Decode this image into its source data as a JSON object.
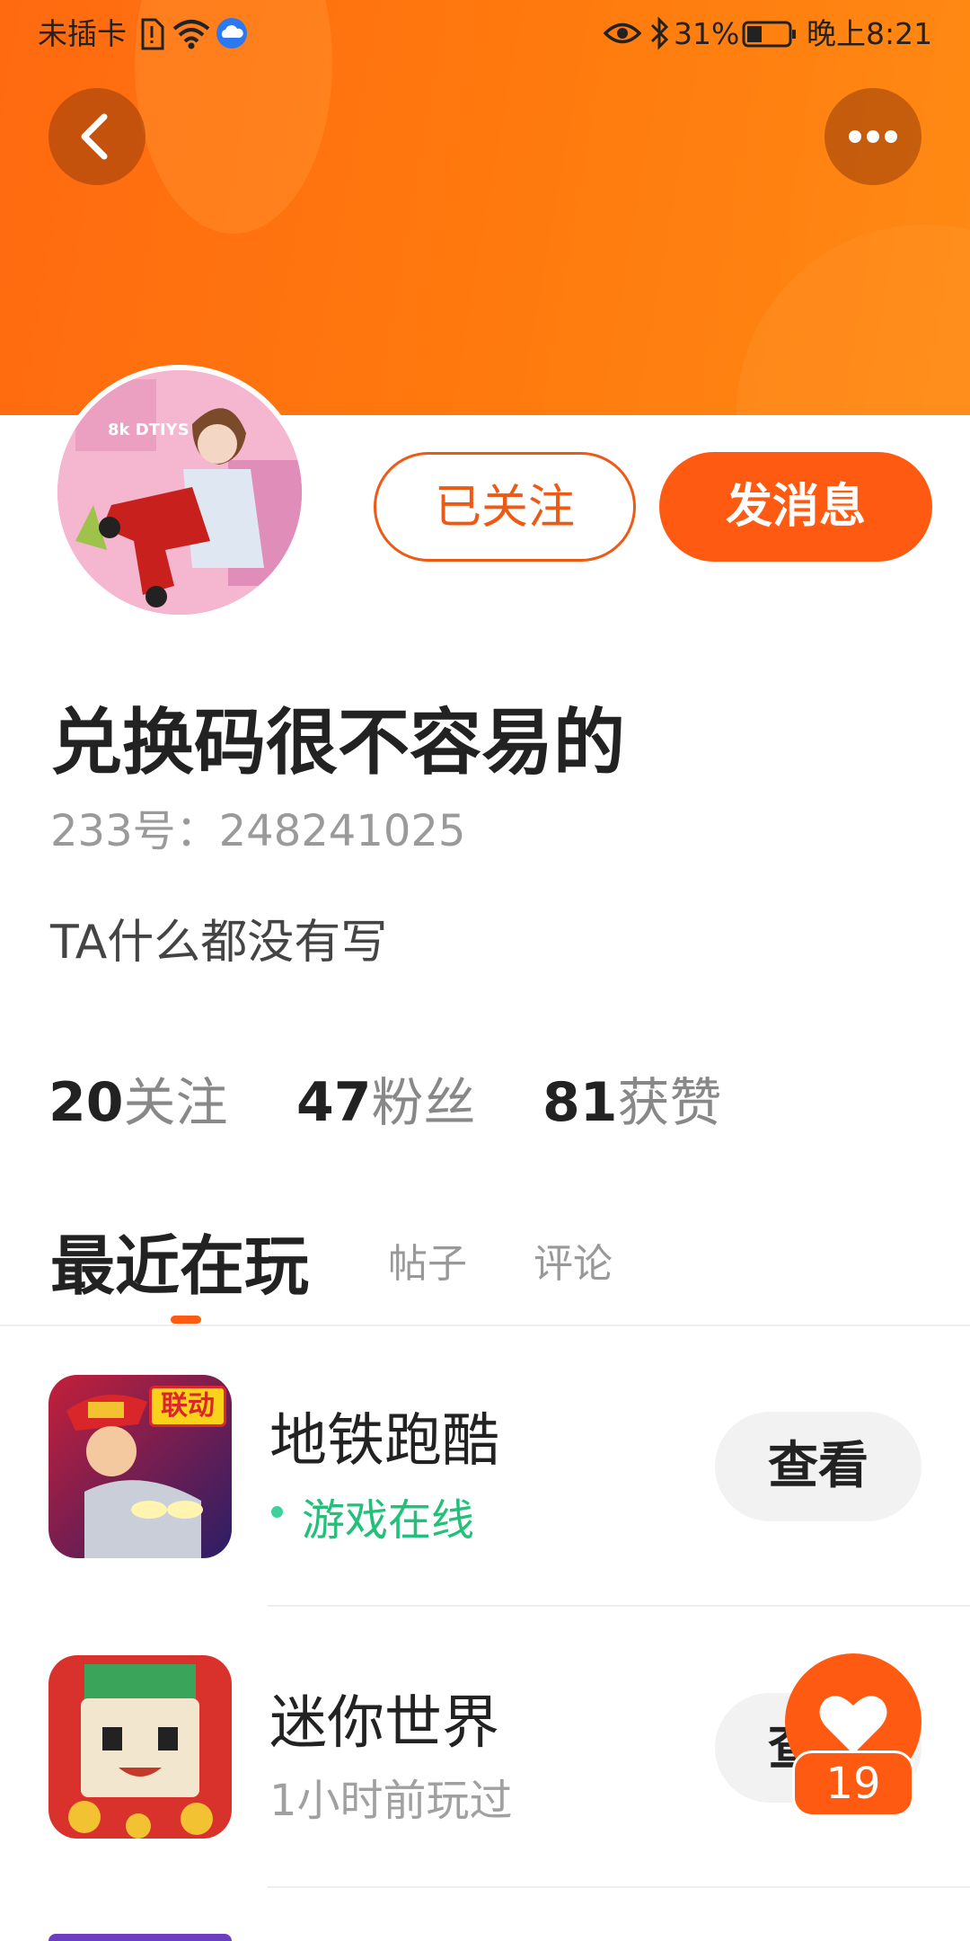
{
  "status_bar": {
    "carrier": "未插卡",
    "battery": "31%",
    "time": "晚上8:21"
  },
  "header": {
    "back_icon": "back-arrow-icon",
    "more_icon": "more-dots-icon",
    "accent_color": "#ff6a10"
  },
  "profile": {
    "avatar_text": "8k DTIYS",
    "follow_button": "已关注",
    "message_button": "发消息",
    "username": "兑换码很不容易的",
    "id_label": "233号：248241025",
    "bio": "TA什么都没有写",
    "stats": [
      {
        "value": "20",
        "label": "关注"
      },
      {
        "value": "47",
        "label": "粉丝"
      },
      {
        "value": "81",
        "label": "获赞"
      }
    ]
  },
  "tabs": [
    {
      "label": "最近在玩",
      "active": true
    },
    {
      "label": "帖子",
      "active": false
    },
    {
      "label": "评论",
      "active": false
    }
  ],
  "games": [
    {
      "name": "地铁跑酷",
      "status": "游戏在线",
      "online": true,
      "badge": "联动",
      "button": "查看"
    },
    {
      "name": "迷你世界",
      "status": "1小时前玩过",
      "online": false,
      "button": "查看"
    }
  ],
  "like_fab": {
    "icon": "heart-icon",
    "count": "19"
  }
}
